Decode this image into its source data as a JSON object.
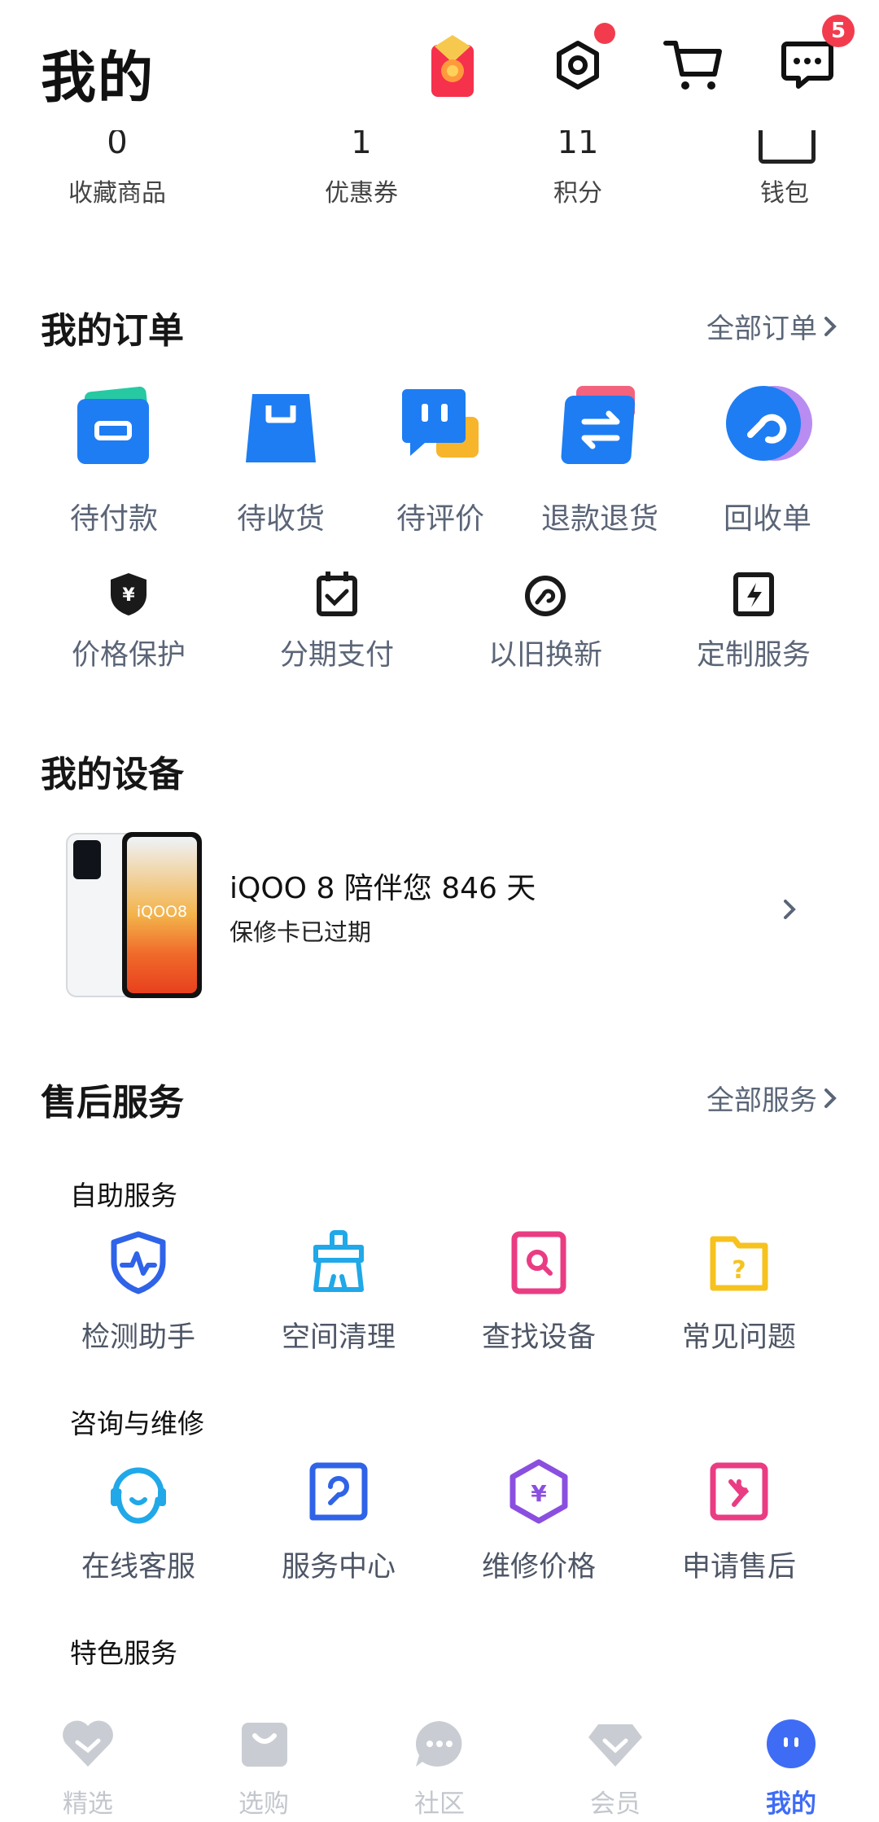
{
  "header": {
    "title": "我的",
    "message_badge": "5"
  },
  "stats": [
    {
      "label": "收藏商品",
      "value": "0"
    },
    {
      "label": "优惠券",
      "value": "1"
    },
    {
      "label": "积分",
      "value": "11"
    },
    {
      "label": "钱包",
      "value": ""
    }
  ],
  "orders": {
    "title": "我的订单",
    "more": "全部订单",
    "items": [
      {
        "label": "待付款",
        "icon": "wallet-icon"
      },
      {
        "label": "待收货",
        "icon": "package-icon"
      },
      {
        "label": "待评价",
        "icon": "review-icon"
      },
      {
        "label": "退款退货",
        "icon": "refund-icon"
      },
      {
        "label": "回收单",
        "icon": "recycle-icon"
      }
    ],
    "services": [
      {
        "label": "价格保护",
        "icon": "price-protect-icon"
      },
      {
        "label": "分期支付",
        "icon": "installment-icon"
      },
      {
        "label": "以旧换新",
        "icon": "trade-in-icon"
      },
      {
        "label": "定制服务",
        "icon": "custom-service-icon"
      }
    ]
  },
  "device": {
    "title": "我的设备",
    "name": "iQOO 8 陪伴您 846 天",
    "warranty": "保修卡已过期",
    "phone_label": "iQOO8"
  },
  "after_sales": {
    "title": "售后服务",
    "more": "全部服务",
    "groups": [
      {
        "title": "自助服务",
        "items": [
          {
            "label": "检测助手",
            "icon": "detect-icon"
          },
          {
            "label": "空间清理",
            "icon": "clean-icon"
          },
          {
            "label": "查找设备",
            "icon": "find-device-icon"
          },
          {
            "label": "常见问题",
            "icon": "faq-icon"
          }
        ]
      },
      {
        "title": "咨询与维修",
        "items": [
          {
            "label": "在线客服",
            "icon": "headset-icon"
          },
          {
            "label": "服务中心",
            "icon": "service-center-icon"
          },
          {
            "label": "维修价格",
            "icon": "repair-price-icon"
          },
          {
            "label": "申请售后",
            "icon": "apply-after-sales-icon"
          }
        ]
      },
      {
        "title": "特色服务",
        "items": []
      }
    ]
  },
  "nav": [
    {
      "label": "精选",
      "icon": "heart-icon",
      "active": false
    },
    {
      "label": "选购",
      "icon": "bag-icon",
      "active": false
    },
    {
      "label": "社区",
      "icon": "chat-icon",
      "active": false
    },
    {
      "label": "会员",
      "icon": "diamond-icon",
      "active": false
    },
    {
      "label": "我的",
      "icon": "profile-icon",
      "active": true
    }
  ],
  "colors": {
    "accent": "#3f6cf5",
    "order_blue": "#1e7df2",
    "badge_red": "#f23c4e"
  }
}
